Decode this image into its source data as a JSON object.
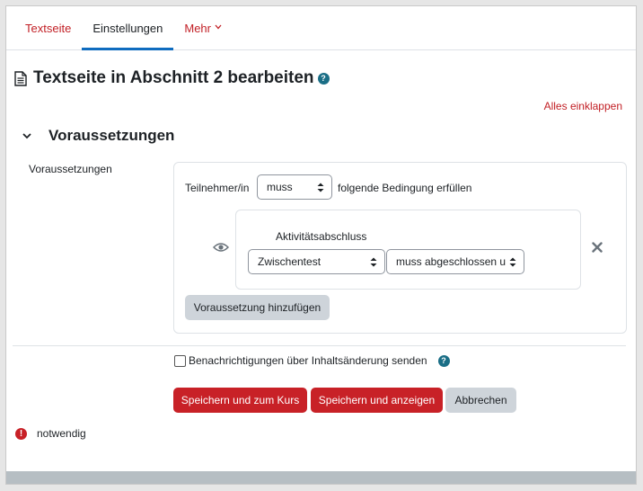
{
  "tabs": [
    {
      "label": "Textseite"
    },
    {
      "label": "Einstellungen",
      "active": true
    },
    {
      "label": "Mehr"
    }
  ],
  "page": {
    "title": "Textseite in Abschnitt 2 bearbeiten",
    "help_glyph": "?"
  },
  "collapse_all": "Alles einklappen",
  "section": {
    "title": "Voraussetzungen",
    "field_label": "Voraussetzungen"
  },
  "availability": {
    "prefix": "Teilnehmer/in",
    "must_select": "muss",
    "suffix": "folgende Bedingung erfüllen",
    "condition_title": "Aktivitätsabschluss",
    "activity_select": "Zwischentest",
    "state_select": "muss abgeschlossen un",
    "add_button": "Voraussetzung hinzufügen"
  },
  "notify": {
    "label": "Benachrichtigungen über Inhaltsänderung senden",
    "checked": false
  },
  "buttons": {
    "save_course": "Speichern und zum Kurs",
    "save_display": "Speichern und anzeigen",
    "cancel": "Abbrechen"
  },
  "required": {
    "glyph": "!",
    "label": "notwendig"
  },
  "colors": {
    "accent": "#c82127",
    "link": "#c22026",
    "help": "#1a6e86",
    "secondary_button": "#ced4da"
  }
}
